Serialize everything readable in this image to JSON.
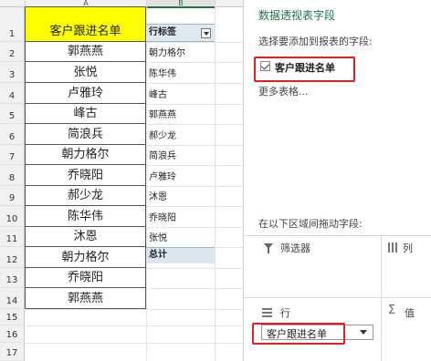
{
  "sheet": {
    "col_headers": [
      "A",
      "B"
    ],
    "row_numbers": [
      "1",
      "2",
      "3",
      "4",
      "5",
      "6",
      "7",
      "8",
      "9",
      "10",
      "11",
      "12",
      "13",
      "14",
      "15",
      "16",
      "17"
    ],
    "column_a_header": "客户跟进名单",
    "column_a": [
      "郭燕燕",
      "张悦",
      "卢雅玲",
      "峰古",
      "简浪兵",
      "朝力格尔",
      "乔晓阳",
      "郝少龙",
      "陈华伟",
      "沐恩",
      "朝力格尔",
      "乔晓阳",
      "郭燕燕"
    ],
    "pivot_header": "行标签",
    "pivot_items": [
      "朝力格尔",
      "陈华伟",
      "峰古",
      "郭燕燕",
      "郝少龙",
      "简浪兵",
      "卢雅玲",
      "沐恩",
      "乔晓阳",
      "张悦"
    ],
    "pivot_total": "总计",
    "header_fill": "#ffff00"
  },
  "pane": {
    "title": "数据透视表字段",
    "subtitle": "选择要添加到报表的字段:",
    "field_name": "客户跟进名单",
    "field_checked": true,
    "more_tables": "更多表格...",
    "drag_hint": "在以下区域间拖动字段:",
    "zones": {
      "filter": "筛选器",
      "columns": "列",
      "rows": "行",
      "values": "值"
    },
    "row_field_chip": "客户跟进名单",
    "accent_color": "#217346",
    "highlight_color": "#e02020"
  }
}
